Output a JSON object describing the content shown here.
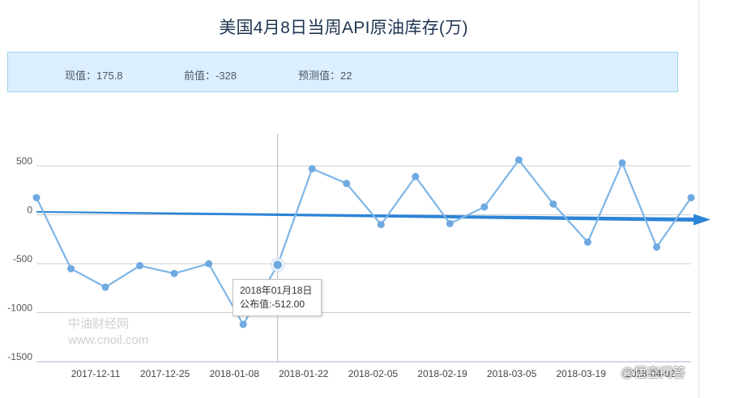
{
  "title": "美国4月8日当周API原油库存(万)",
  "info": {
    "current": "现值：175.8",
    "previous": "前值：-328",
    "forecast": "预测值：22"
  },
  "tooltip": {
    "date": "2018年01月18日",
    "value": "公布值:-512.00"
  },
  "watermark": {
    "line1": "中油财经网",
    "line2": "www.cnoil.com"
  },
  "brand": "@悟空问答",
  "colors": {
    "line": "#7db5e6",
    "point": "#6fa9e0",
    "trend": "#2c84d6",
    "grid": "#cfcfcf"
  },
  "chart_data": {
    "type": "line",
    "title": "美国4月8日当周API原油库存(万)",
    "xlabel": "",
    "ylabel": "",
    "ylim": [
      -1500,
      500
    ],
    "y_ticks": [
      "500",
      "0",
      "-500",
      "-1000",
      "-1500"
    ],
    "x_tick_labels": [
      "2017-12-11",
      "2017-12-25",
      "2018-01-08",
      "2018-01-22",
      "2018-02-05",
      "2018-02-19",
      "2018-03-05",
      "2018-03-19",
      "2018-04-02"
    ],
    "grid": true,
    "legend": "none",
    "series": [
      {
        "values": [
          175,
          -550,
          -740,
          -520,
          -600,
          -500,
          -1120,
          -512,
          470,
          320,
          -100,
          390,
          -90,
          80,
          560,
          110,
          -280,
          530,
          -330,
          175
        ]
      }
    ],
    "trend_line": {
      "start": 30,
      "end": -50
    },
    "highlight": {
      "index": 7,
      "date": "2018-01-18",
      "value": -512
    }
  }
}
